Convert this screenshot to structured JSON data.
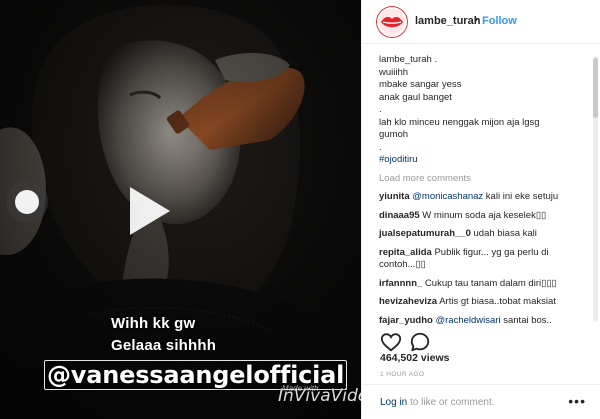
{
  "video": {
    "caption_line1": "Wihh kk gw",
    "caption_line2": "Gelaaa sihhhh",
    "mention_tag": "@vanessaangelofficial",
    "watermark_small": "Made with",
    "watermark": "VivaVideo",
    "watermark_prefix": "In"
  },
  "header": {
    "username": "lambe_turah",
    "separator": "•",
    "follow_label": "Follow"
  },
  "post": {
    "caption_lines": [
      "lambe_turah .",
      "wuiiihh",
      "mbake sangar yess",
      "anak gaul banget",
      ".",
      "lah klo minceu nenggak mijon aja lgsg",
      "gumoh",
      "."
    ],
    "hashtag": "#ojoditiru",
    "load_more": "Load more comments",
    "comments": [
      {
        "user": "yiunita",
        "mention": "@monicashanaz",
        "text": " kali ini eke setuju"
      },
      {
        "user": "dinaaa95",
        "mention": "",
        "text": " W minum soda aja keselek▯▯"
      },
      {
        "user": "jualsepatumurah__0",
        "mention": "",
        "text": " udah biasa kali"
      },
      {
        "user": "repita_alida",
        "mention": "",
        "text": " Publik figur... yg ga perlu di contoh...▯▯"
      },
      {
        "user": "irfannnn_",
        "mention": "",
        "text": " Cukup tau tanam dalam diri▯▯▯"
      },
      {
        "user": "hevizaheviza",
        "mention": "",
        "text": " Artis gt biasa..tobat maksiat"
      },
      {
        "user": "fajar_yudho",
        "mention": "@racheldwisari",
        "text": " santai bos.."
      }
    ],
    "views": "464,502 views",
    "time": "1 HOUR AGO",
    "login_link": "Log in",
    "login_rest": " to like or comment.",
    "more_dots": "•••"
  },
  "colors": {
    "accent": "#3897f0",
    "link": "#003569",
    "muted": "#999999",
    "avatar_ring": "#e0232c"
  },
  "icons": [
    "play-icon",
    "heart-icon",
    "comment-icon",
    "more-options-icon",
    "lips-logo-icon"
  ]
}
